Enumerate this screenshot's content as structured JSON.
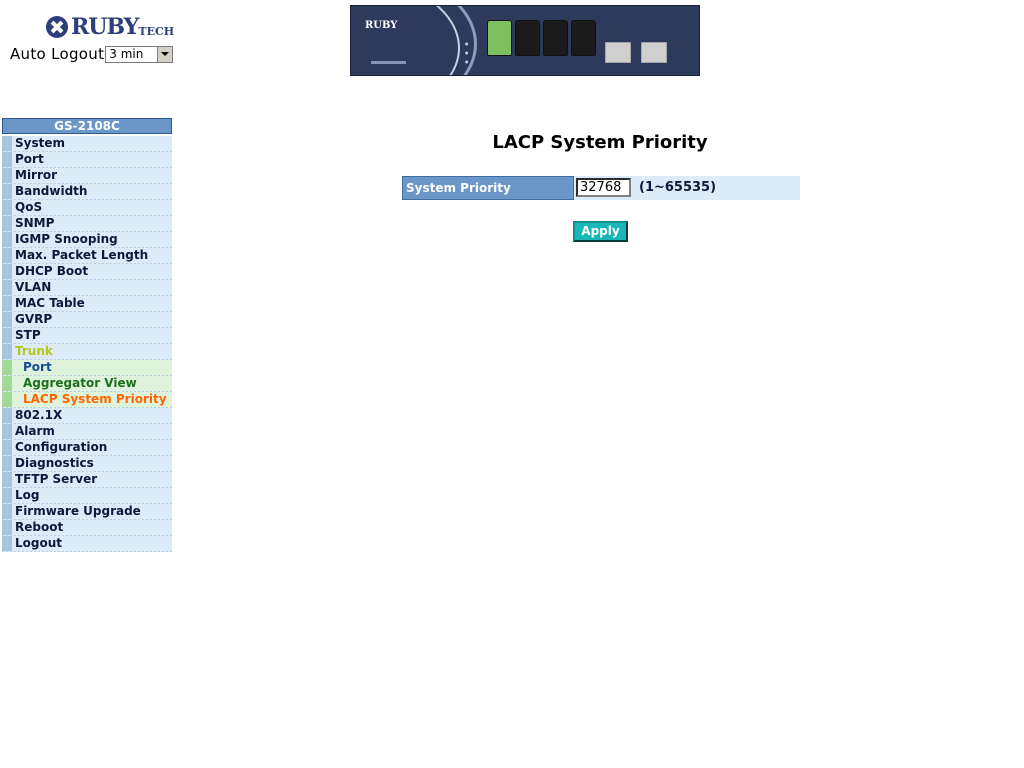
{
  "header": {
    "logo_text": "RUBY",
    "logo_suffix": "TECH",
    "auto_logout_label": "Auto Logout",
    "auto_logout_value": "3 min"
  },
  "sidebar": {
    "title": "GS-2108C",
    "items": [
      {
        "label": "System"
      },
      {
        "label": "Port"
      },
      {
        "label": "Mirror"
      },
      {
        "label": "Bandwidth"
      },
      {
        "label": "QoS"
      },
      {
        "label": "SNMP"
      },
      {
        "label": "IGMP Snooping"
      },
      {
        "label": "Max. Packet Length"
      },
      {
        "label": "DHCP Boot"
      },
      {
        "label": "VLAN"
      },
      {
        "label": "MAC Table"
      },
      {
        "label": "GVRP"
      },
      {
        "label": "STP"
      },
      {
        "label": "Trunk"
      },
      {
        "label": "Port"
      },
      {
        "label": "Aggregator View"
      },
      {
        "label": "LACP System Priority"
      },
      {
        "label": "802.1X"
      },
      {
        "label": "Alarm"
      },
      {
        "label": "Configuration"
      },
      {
        "label": "Diagnostics"
      },
      {
        "label": "TFTP Server"
      },
      {
        "label": "Log"
      },
      {
        "label": "Firmware Upgrade"
      },
      {
        "label": "Reboot"
      },
      {
        "label": "Logout"
      }
    ]
  },
  "main": {
    "title": "LACP System Priority",
    "priority_label": "System Priority",
    "priority_value": "32768",
    "priority_range": "(1~65535)",
    "apply_label": "Apply"
  }
}
